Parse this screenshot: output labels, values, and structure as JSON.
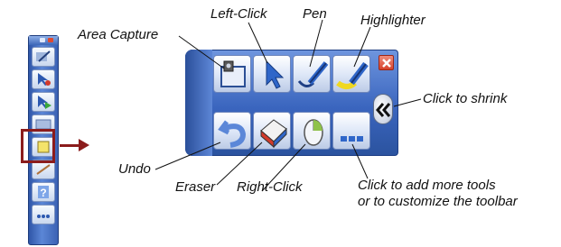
{
  "callouts": {
    "area_capture": "Area Capture",
    "left_click": "Left-Click",
    "pen": "Pen",
    "highlighter": "Highlighter",
    "click_to_shrink": "Click to shrink",
    "undo": "Undo",
    "eraser": "Eraser",
    "right_click": "Right-Click",
    "more_tools_line1": "Click to add more tools",
    "more_tools_line2": "or to customize the toolbar"
  },
  "colors": {
    "toolbar_blue": "#3a65be",
    "highlight_frame": "#8b1c1c",
    "close_red": "#d6432c"
  },
  "icons": {
    "area_capture": "area-capture-icon",
    "left_click": "cursor-arrow-icon",
    "pen": "pen-icon",
    "highlighter": "highlighter-icon",
    "undo": "undo-icon",
    "eraser": "eraser-icon",
    "right_click": "mouse-icon",
    "more_tools": "more-dots-icon",
    "close": "close-icon",
    "shrink": "chevron-left-icon"
  }
}
